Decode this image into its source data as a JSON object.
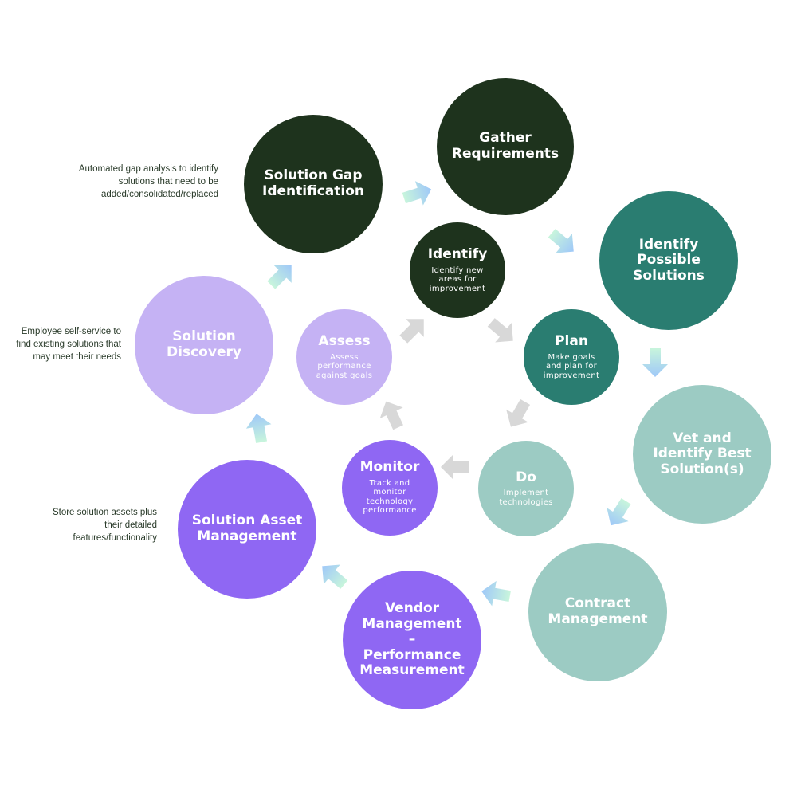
{
  "outer_cycle": [
    {
      "id": "gather",
      "title": "Gather\nRequirements",
      "color": "#1e331d",
      "text_color": "#ffffff"
    },
    {
      "id": "identify-possible",
      "title": "Identify\nPossible\nSolutions",
      "color": "#2a7d71",
      "text_color": "#ffffff"
    },
    {
      "id": "vet",
      "title": "Vet and\nIdentify Best\nSolution(s)",
      "color": "#9ccbc3",
      "text_color": "#ffffff"
    },
    {
      "id": "contract",
      "title": "Contract\nManagement",
      "color": "#9ccbc3",
      "text_color": "#ffffff"
    },
    {
      "id": "vendor",
      "title": "Vendor\nManagement\n–\nPerformance\nMeasurement",
      "color": "#8f67f3",
      "text_color": "#ffffff"
    },
    {
      "id": "asset",
      "title": "Solution Asset\nManagement",
      "color": "#8f67f3",
      "text_color": "#ffffff"
    },
    {
      "id": "discovery",
      "title": "Solution\nDiscovery",
      "color": "#c5b2f4",
      "text_color": "#ffffff"
    },
    {
      "id": "gap",
      "title": "Solution Gap\nIdentification",
      "color": "#1e331d",
      "text_color": "#ffffff"
    }
  ],
  "inner_cycle": [
    {
      "id": "identify",
      "title": "Identify",
      "desc": "Identify new\nareas for\nimprovement",
      "color": "#1e331d"
    },
    {
      "id": "plan",
      "title": "Plan",
      "desc": "Make goals\nand plan for\nimprovement",
      "color": "#2a7d71"
    },
    {
      "id": "do",
      "title": "Do",
      "desc": "Implement\ntechnologies",
      "color": "#9ccbc3"
    },
    {
      "id": "monitor",
      "title": "Monitor",
      "desc": "Track and\nmonitor\ntechnology\nperformance",
      "color": "#8f67f3"
    },
    {
      "id": "assess",
      "title": "Assess",
      "desc": "Assess\nperformance\nagainst goals",
      "color": "#c5b2f4"
    }
  ],
  "notes": {
    "gap": "Automated gap analysis to identify\nsolutions that need to be\nadded/consolidated/replaced",
    "discovery": "Employee self-service to\nfind existing solutions that\nmay meet their needs",
    "asset": "Store solution assets plus\ntheir detailed\nfeatures/functionality"
  },
  "arrow_colors": {
    "outer_start": "#c8f5dc",
    "outer_end": "#9fc8f8",
    "inner": "#d8d8d8"
  }
}
